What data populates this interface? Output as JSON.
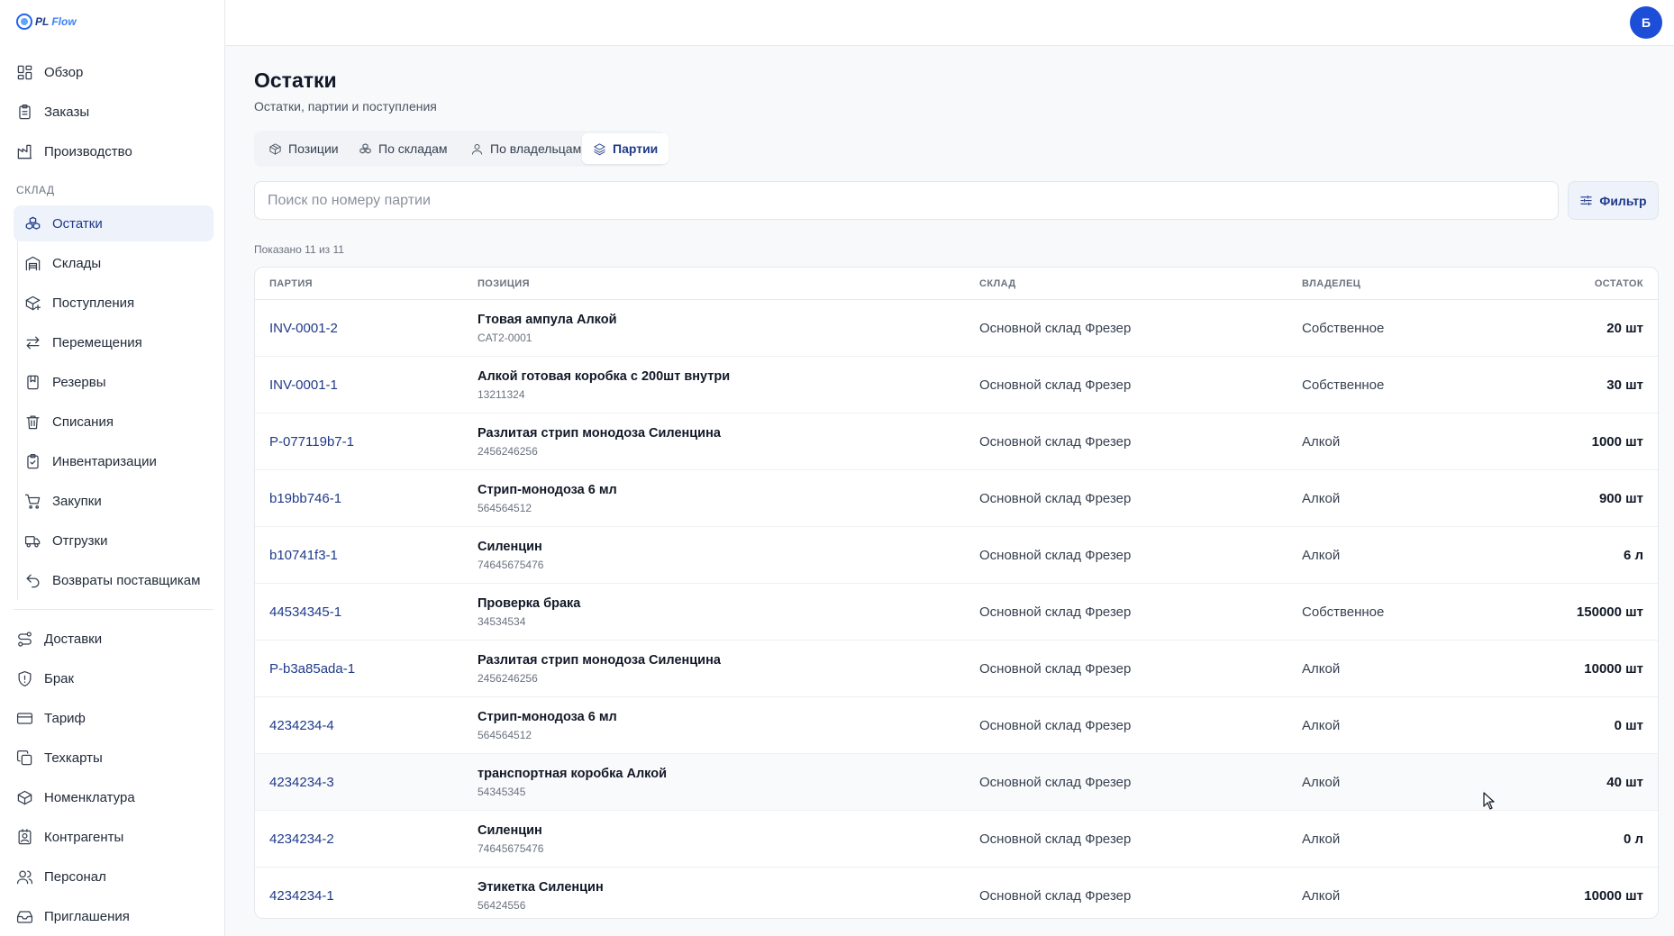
{
  "app": {
    "logo_pl": "PL",
    "logo_flow": "Flow"
  },
  "user": {
    "avatar_initial": "Б"
  },
  "sidebar": {
    "top_items": [
      {
        "label": "Обзор",
        "icon": "grid-icon"
      },
      {
        "label": "Заказы",
        "icon": "clipboard-icon"
      },
      {
        "label": "Производство",
        "icon": "factory-icon"
      }
    ],
    "section_title": "СКЛАД",
    "warehouse_items": [
      {
        "label": "Остатки",
        "icon": "boxes-icon",
        "active": true
      },
      {
        "label": "Склады",
        "icon": "warehouse-icon"
      },
      {
        "label": "Поступления",
        "icon": "package-plus-icon"
      },
      {
        "label": "Перемещения",
        "icon": "arrows-swap-icon"
      },
      {
        "label": "Резервы",
        "icon": "bookmark-icon"
      },
      {
        "label": "Списания",
        "icon": "trash-icon"
      },
      {
        "label": "Инвентаризации",
        "icon": "clipboard-check-icon"
      },
      {
        "label": "Закупки",
        "icon": "cart-icon"
      },
      {
        "label": "Отгрузки",
        "icon": "truck-icon"
      },
      {
        "label": "Возвраты поставщикам",
        "icon": "undo-icon"
      }
    ],
    "bottom_items": [
      {
        "label": "Доставки",
        "icon": "route-icon"
      },
      {
        "label": "Брак",
        "icon": "shield-alert-icon"
      },
      {
        "label": "Тариф",
        "icon": "credit-card-icon"
      },
      {
        "label": "Техкарты",
        "icon": "copy-icon"
      },
      {
        "label": "Номенклатура",
        "icon": "box-icon"
      },
      {
        "label": "Контрагенты",
        "icon": "contact-icon"
      },
      {
        "label": "Персонал",
        "icon": "users-icon"
      },
      {
        "label": "Приглашения",
        "icon": "inbox-icon"
      }
    ]
  },
  "page": {
    "title": "Остатки",
    "subtitle": "Остатки, партии и поступления"
  },
  "tabs": [
    {
      "label": "Позиции",
      "icon": "package-icon"
    },
    {
      "label": "По складам",
      "icon": "boxes-icon"
    },
    {
      "label": "По владельцам",
      "icon": "user-icon"
    },
    {
      "label": "Партии",
      "icon": "layers-icon",
      "active": true
    }
  ],
  "search": {
    "placeholder": "Поиск по номеру партии",
    "value": ""
  },
  "filter": {
    "label": "Фильтр",
    "icon": "sliders-icon"
  },
  "shown_count": "Показано 11 из 11",
  "table": {
    "headers": {
      "batch": "ПАРТИЯ",
      "item": "ПОЗИЦИЯ",
      "warehouse": "СКЛАД",
      "owner": "ВЛАДЕЛЕЦ",
      "qty": "ОСТАТОК"
    },
    "rows": [
      {
        "batch": "INV-0001-2",
        "item_name": "Гтовая ампула Алкой",
        "item_code": "CAT2-0001",
        "warehouse": "Основной склад Фрезер",
        "owner": "Собственное",
        "qty": "20 шт"
      },
      {
        "batch": "INV-0001-1",
        "item_name": "Алкой готовая коробка с 200шт внутри",
        "item_code": "13211324",
        "warehouse": "Основной склад Фрезер",
        "owner": "Собственное",
        "qty": "30 шт"
      },
      {
        "batch": "P-077119b7-1",
        "item_name": "Разлитая стрип монодоза Силенцина",
        "item_code": "2456246256",
        "warehouse": "Основной склад Фрезер",
        "owner": "Алкой",
        "qty": "1000 шт"
      },
      {
        "batch": "b19bb746-1",
        "item_name": "Стрип-монодоза 6 мл",
        "item_code": "564564512",
        "warehouse": "Основной склад Фрезер",
        "owner": "Алкой",
        "qty": "900 шт"
      },
      {
        "batch": "b10741f3-1",
        "item_name": "Силенцин",
        "item_code": "74645675476",
        "warehouse": "Основной склад Фрезер",
        "owner": "Алкой",
        "qty": "6 л"
      },
      {
        "batch": "44534345-1",
        "item_name": "Проверка брака",
        "item_code": "34534534",
        "warehouse": "Основной склад Фрезер",
        "owner": "Собственное",
        "qty": "150000 шт"
      },
      {
        "batch": "P-b3a85ada-1",
        "item_name": "Разлитая стрип монодоза Силенцина",
        "item_code": "2456246256",
        "warehouse": "Основной склад Фрезер",
        "owner": "Алкой",
        "qty": "10000 шт"
      },
      {
        "batch": "4234234-4",
        "item_name": "Стрип-монодоза 6 мл",
        "item_code": "564564512",
        "warehouse": "Основной склад Фрезер",
        "owner": "Алкой",
        "qty": "0 шт"
      },
      {
        "batch": "4234234-3",
        "item_name": "транспортная коробка Алкой",
        "item_code": "54345345",
        "warehouse": "Основной склад Фрезер",
        "owner": "Алкой",
        "qty": "40 шт"
      },
      {
        "batch": "4234234-2",
        "item_name": "Силенцин",
        "item_code": "74645675476",
        "warehouse": "Основной склад Фрезер",
        "owner": "Алкой",
        "qty": "0 л"
      },
      {
        "batch": "4234234-1",
        "item_name": "Этикетка Силенцин",
        "item_code": "56424556",
        "warehouse": "Основной склад Фрезер",
        "owner": "Алкой",
        "qty": "10000 шт"
      }
    ]
  },
  "colors": {
    "accent": "#1e3a8a",
    "avatar_bg": "#1d4ed8",
    "active_bg": "#eef2fb"
  }
}
